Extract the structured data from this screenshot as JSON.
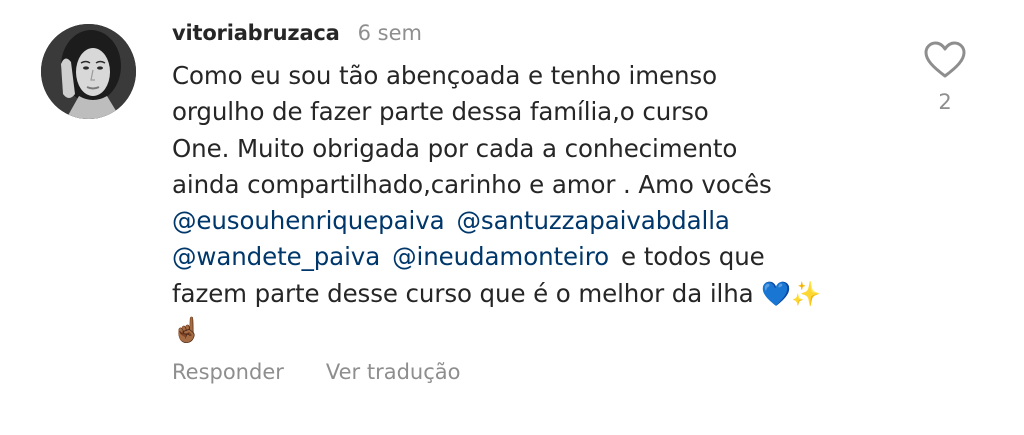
{
  "comment": {
    "username": "vitoriabruzaca",
    "time": "6 sem",
    "text_lines": [
      "Como eu sou tão abençoada e tenho imenso",
      "orgulho de fazer parte dessa família,o curso",
      "One. Muito obrigada por cada a conhecimento",
      "ainda compartilhado,carinho e amor . Amo vocês"
    ],
    "mentions": [
      "@eusouhenriquepaiva",
      "@santuzzapaivabdalla",
      "@wandete_paiva",
      "@ineudamonteiro"
    ],
    "text_after_mentions": "e todos que",
    "text_line_final": "fazem parte desse curso que é o melhor da ilha",
    "emojis": {
      "heart": "💙",
      "sparkles": "✨",
      "pointing": "☝🏾"
    },
    "like_count": "2",
    "actions": {
      "reply_label": "Responder",
      "translate_label": "Ver tradução"
    },
    "icons": {
      "like": "heart-outline-icon"
    },
    "colors": {
      "mention": "#00376b",
      "secondary_text": "#8e8e8e",
      "primary_text": "#262626"
    }
  }
}
